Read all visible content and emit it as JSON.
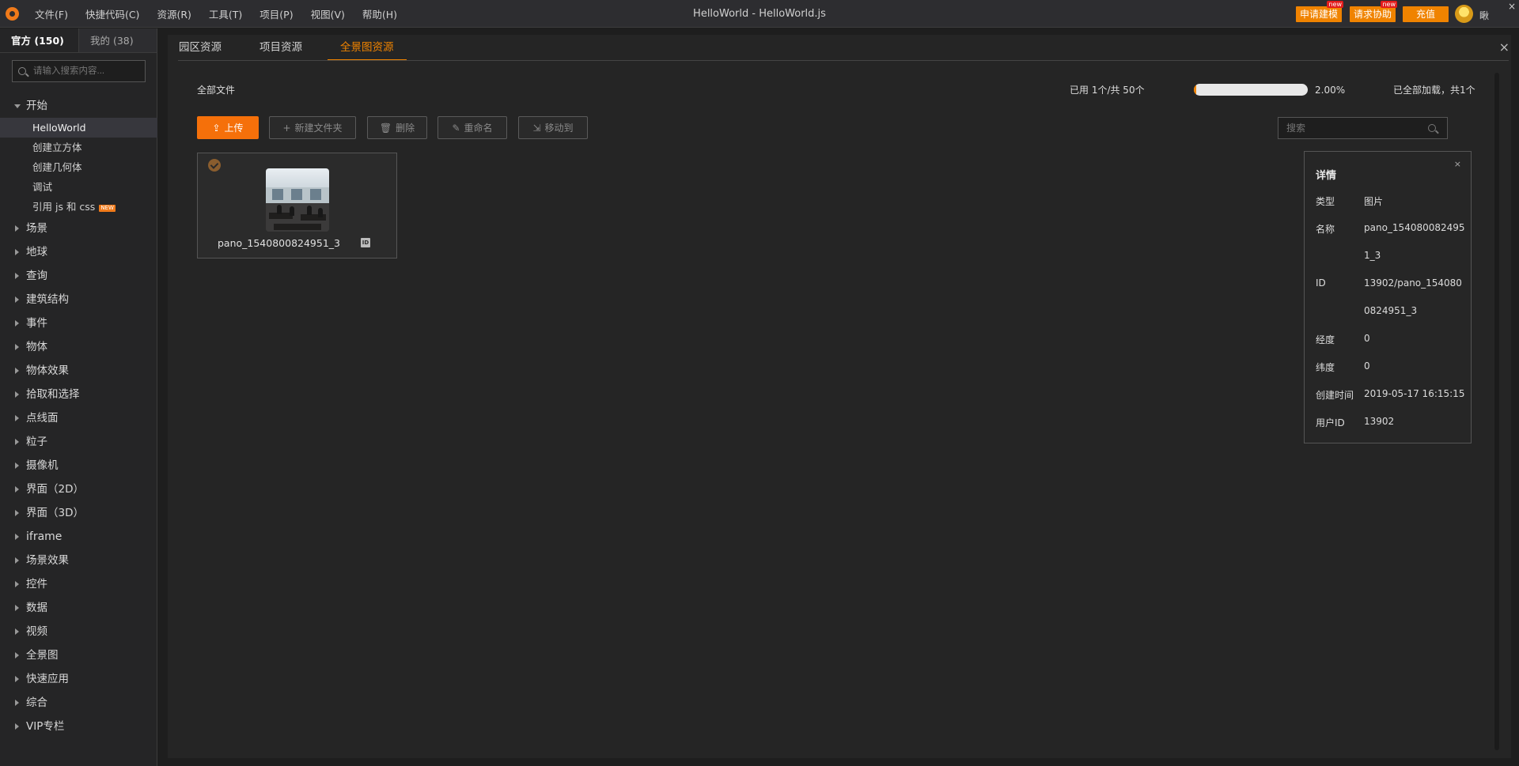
{
  "app": {
    "title": "HelloWorld -  HelloWorld.js",
    "menu": [
      "文件(F)",
      "快捷代码(C)",
      "资源(R)",
      "工具(T)",
      "项目(P)",
      "视图(V)",
      "帮助(H)"
    ],
    "top_buttons": {
      "apply_model": "申请建模",
      "request_help": "请求协助",
      "recharge": "充值",
      "new_badge": "new"
    },
    "user_text": "瞅",
    "close_glyph": "×"
  },
  "sidebar": {
    "tabs": [
      "官方 (150)",
      "我的 (38)"
    ],
    "search_placeholder": "请输入搜索内容...",
    "start_group": "开始",
    "start_items": [
      "HelloWorld",
      "创建立方体",
      "创建几何体",
      "调试",
      "引用 js 和 css"
    ],
    "new_tag": "NEW",
    "groups": [
      "场景",
      "地球",
      "查询",
      "建筑结构",
      "事件",
      "物体",
      "物体效果",
      "拾取和选择",
      "点线面",
      "粒子",
      "摄像机",
      "界面（2D）",
      "界面（3D）",
      "iframe",
      "场景效果",
      "控件",
      "数据",
      "视频",
      "全景图",
      "快速应用",
      "综合",
      "VIP专栏"
    ]
  },
  "main": {
    "tabs": [
      "园区资源",
      "项目资源",
      "全景图资源"
    ],
    "close_glyph": "×",
    "breadcrumb": "全部文件",
    "usage_text": "已用 1个/共 50个",
    "usage_fraction": 0.02,
    "usage_percent": "2.00%",
    "loaded_text": "已全部加载，共1个",
    "buttons": {
      "upload": "上传",
      "new_folder": "新建文件夹",
      "delete": "删除",
      "rename": "重命名",
      "move_to": "移动到"
    },
    "search_placeholder": "搜索",
    "file": {
      "name": "pano_1540800824951_3",
      "id_badge": "ID"
    },
    "detail": {
      "title": "详情",
      "close_glyph": "×",
      "type_label": "类型",
      "type_value": "图片",
      "name_label": "名称",
      "name_line1": "pano_154080082495",
      "name_line2": "1_3",
      "id_label": "ID",
      "id_line1": "13902/pano_154080",
      "id_line2": "0824951_3",
      "lng_label": "经度",
      "lng_value": "0",
      "lat_label": "纬度",
      "lat_value": "0",
      "created_label": "创建时间",
      "created_value": "2019-05-17 16:15:15",
      "userid_label": "用户ID",
      "userid_value": "13902"
    }
  },
  "colors": {
    "accent": "#f08300",
    "upload": "#f5700a",
    "new_badge": "#e21c1c"
  }
}
